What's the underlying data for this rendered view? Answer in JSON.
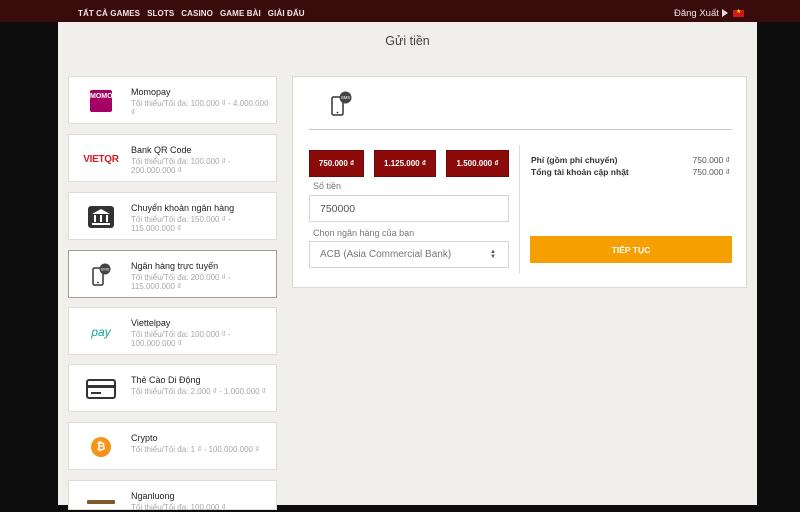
{
  "topbar": {
    "nav": [
      "TẤT CẢ GAMES",
      "SLOTS",
      "CASINO",
      "GAME BÀI",
      "GIẢI ĐẤU"
    ],
    "logout": "Đăng Xuất"
  },
  "page": {
    "title": "Gửi tiền"
  },
  "methods": [
    {
      "name": "Momopay",
      "limit": "Tối thiểu/Tối đa: 100.000 ₫ - 4.000.000 ₫",
      "logo": "MOMO"
    },
    {
      "name": "Bank QR Code",
      "limit": "Tối thiểu/Tối đa: 100.000 ₫ - 200.000.000 ₫",
      "logo": "VIETQR"
    },
    {
      "name": "Chuyển khoản ngân hàng",
      "limit": "Tối thiểu/Tối đa: 150.000 ₫ - 115.000.000 ₫"
    },
    {
      "name": "Ngân hàng trực tuyến",
      "limit": "Tối thiểu/Tối đa: 200.000 ₫ - 115.000.000 ₫"
    },
    {
      "name": "Viettelpay",
      "limit": "Tối thiểu/Tối đa: 100.000 ₫ - 100.000.000 ₫",
      "logo": "pay"
    },
    {
      "name": "Thẻ Cào Di Động",
      "limit": "Tối thiểu/Tối đa: 2.000 ₫ - 1.000.000 ₫"
    },
    {
      "name": "Crypto",
      "limit": "Tối thiểu/Tối đa: 1 ₫ - 100.000.000 ₫"
    },
    {
      "name": "Nganluong",
      "limit": "Tối thiểu/Tối đa: 100.000 ₫"
    }
  ],
  "form": {
    "sms_badge": "SMS",
    "amount_buttons": [
      "750.000 ₫",
      "1.125.000 ₫",
      "1.500.000 ₫"
    ],
    "amount_label": "Số tiền",
    "amount_value": "750000",
    "bank_label": "Chọn ngân hàng của bạn",
    "bank_selected": "ACB (Asia Commercial Bank)",
    "fee_label": "Phí (gồm phí chuyển)",
    "fee_value": "750.000 ₫",
    "total_label": "Tổng tài khoản cập nhật",
    "total_value": "750.000 ₫",
    "continue_label": "TIẾP TỤC"
  },
  "colors": {
    "accent": "#8b0b0b",
    "cta": "#f59f00",
    "topbar": "#3a0b0b",
    "momo": "#a50064"
  }
}
